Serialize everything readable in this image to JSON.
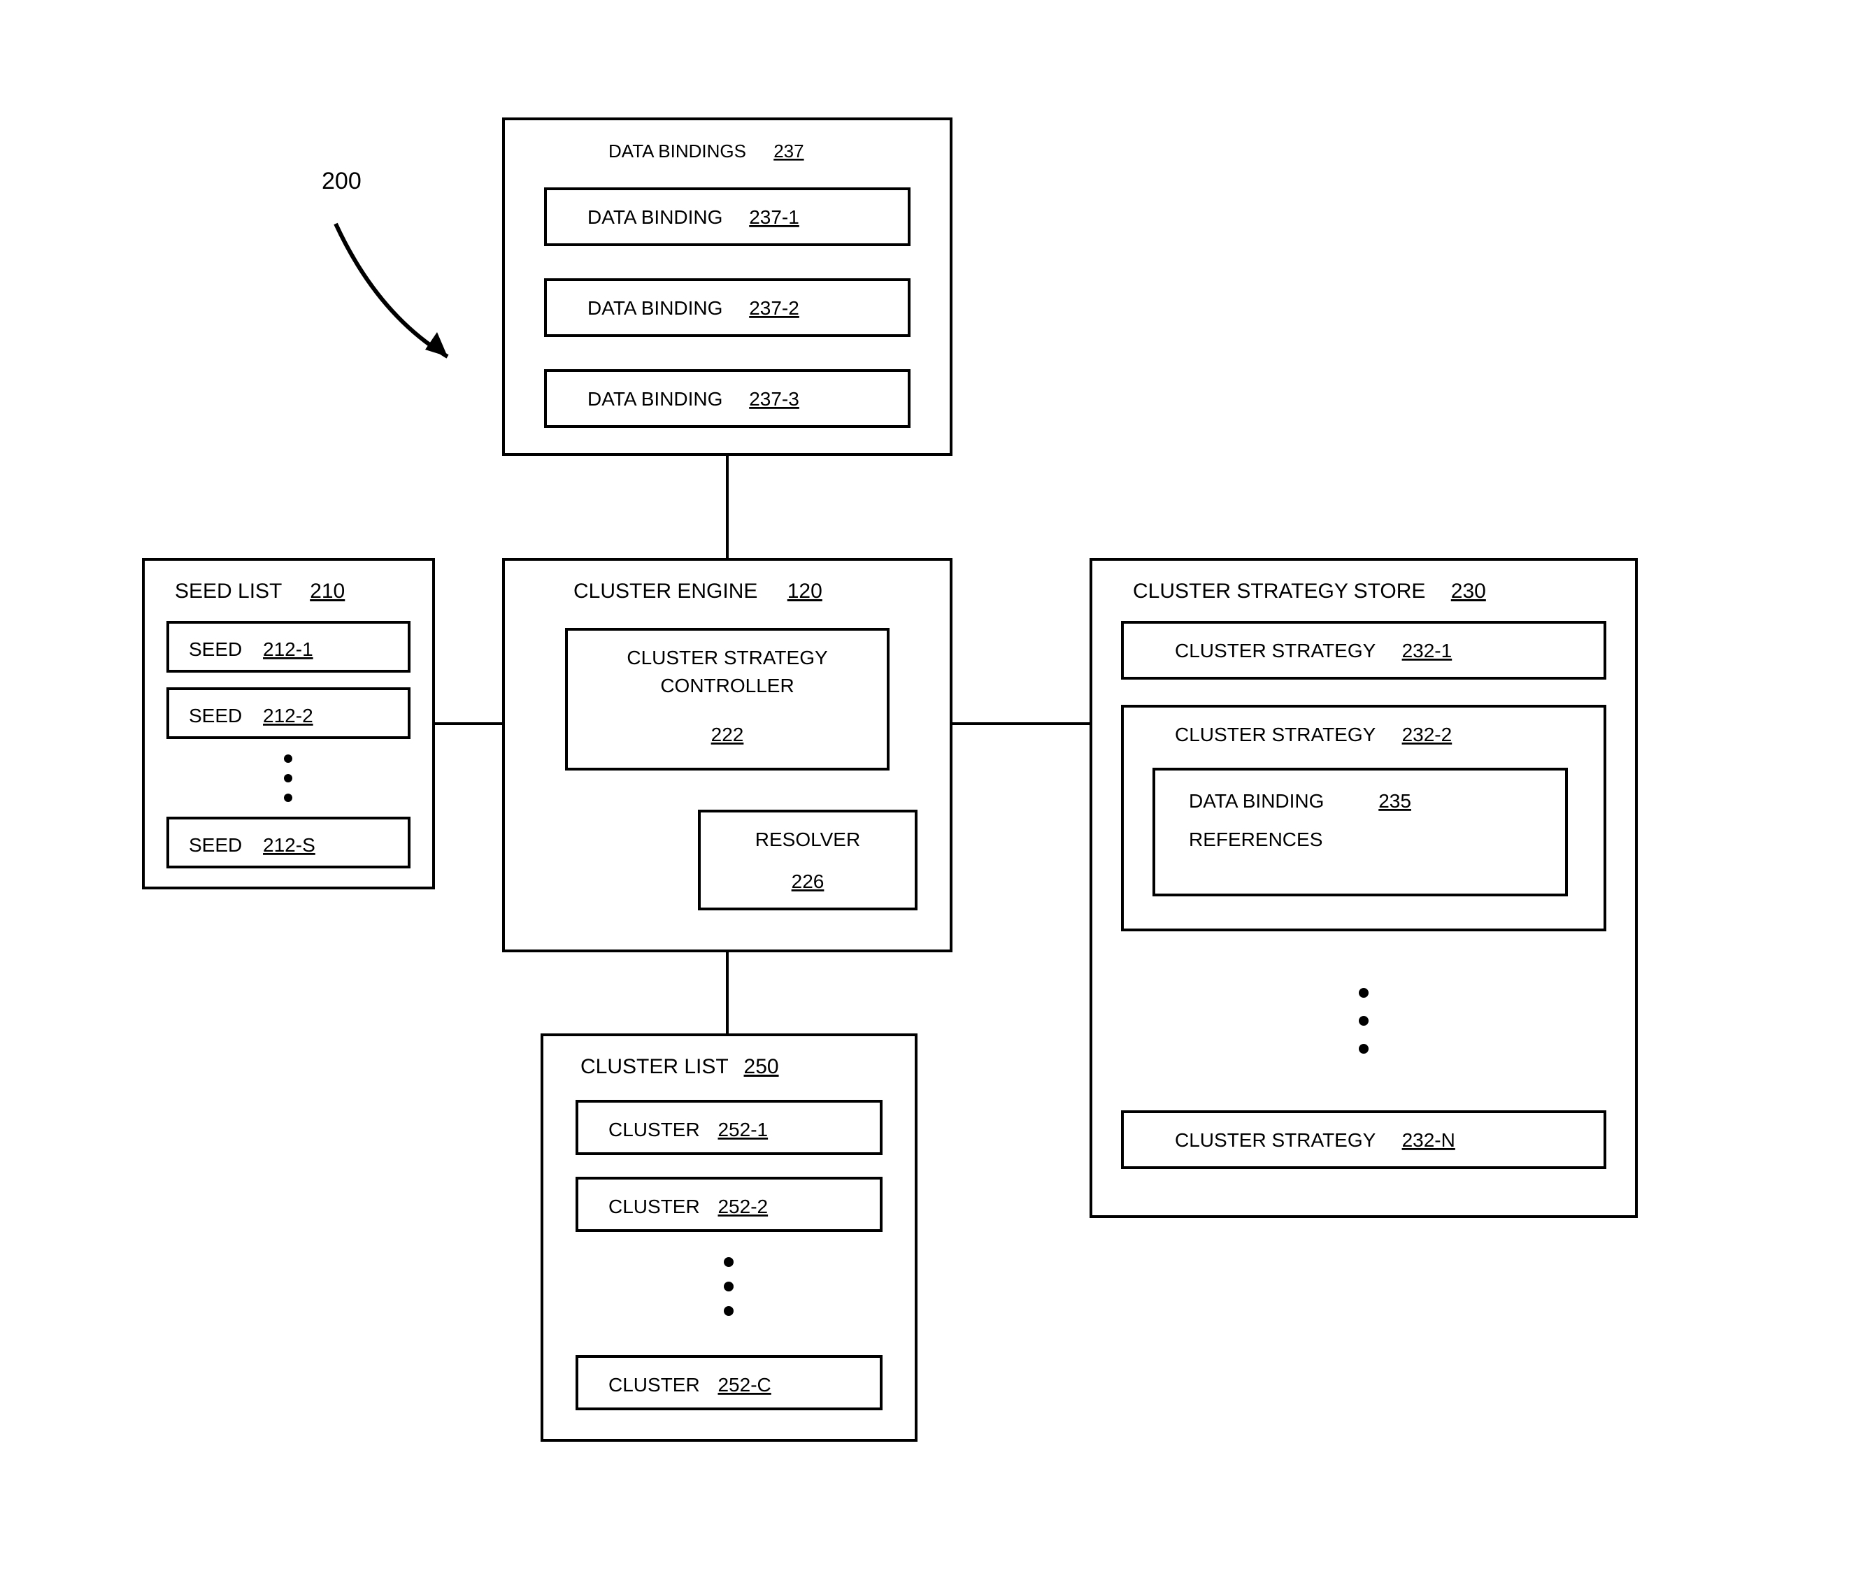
{
  "callout": "200",
  "data_bindings": {
    "title": "DATA BINDINGS",
    "ref": "237",
    "items": [
      {
        "label": "DATA BINDING",
        "ref": "237-1"
      },
      {
        "label": "DATA BINDING",
        "ref": "237-2"
      },
      {
        "label": "DATA BINDING",
        "ref": "237-3"
      }
    ]
  },
  "seed_list": {
    "title": "SEED LIST",
    "ref": "210",
    "items": [
      {
        "label": "SEED",
        "ref": "212-1"
      },
      {
        "label": "SEED",
        "ref": "212-2"
      },
      {
        "label": "SEED",
        "ref": "212-S"
      }
    ]
  },
  "cluster_engine": {
    "title": "CLUSTER ENGINE",
    "ref": "120",
    "controller": {
      "label_line1": "CLUSTER STRATEGY",
      "label_line2": "CONTROLLER",
      "ref": "222"
    },
    "resolver": {
      "label": "RESOLVER",
      "ref": "226"
    }
  },
  "cluster_strategy_store": {
    "title": "CLUSTER STRATEGY STORE",
    "ref": "230",
    "items": [
      {
        "label": "CLUSTER STRATEGY",
        "ref": "232-1"
      },
      {
        "label": "CLUSTER STRATEGY",
        "ref": "232-2",
        "nested": {
          "label_line1": "DATA BINDING",
          "label_line2": "REFERENCES",
          "ref": "235"
        }
      },
      {
        "label": "CLUSTER STRATEGY",
        "ref": "232-N"
      }
    ]
  },
  "cluster_list": {
    "title": "CLUSTER LIST",
    "ref": "250",
    "items": [
      {
        "label": "CLUSTER",
        "ref": "252-1"
      },
      {
        "label": "CLUSTER",
        "ref": "252-2"
      },
      {
        "label": "CLUSTER",
        "ref": "252-C"
      }
    ]
  }
}
